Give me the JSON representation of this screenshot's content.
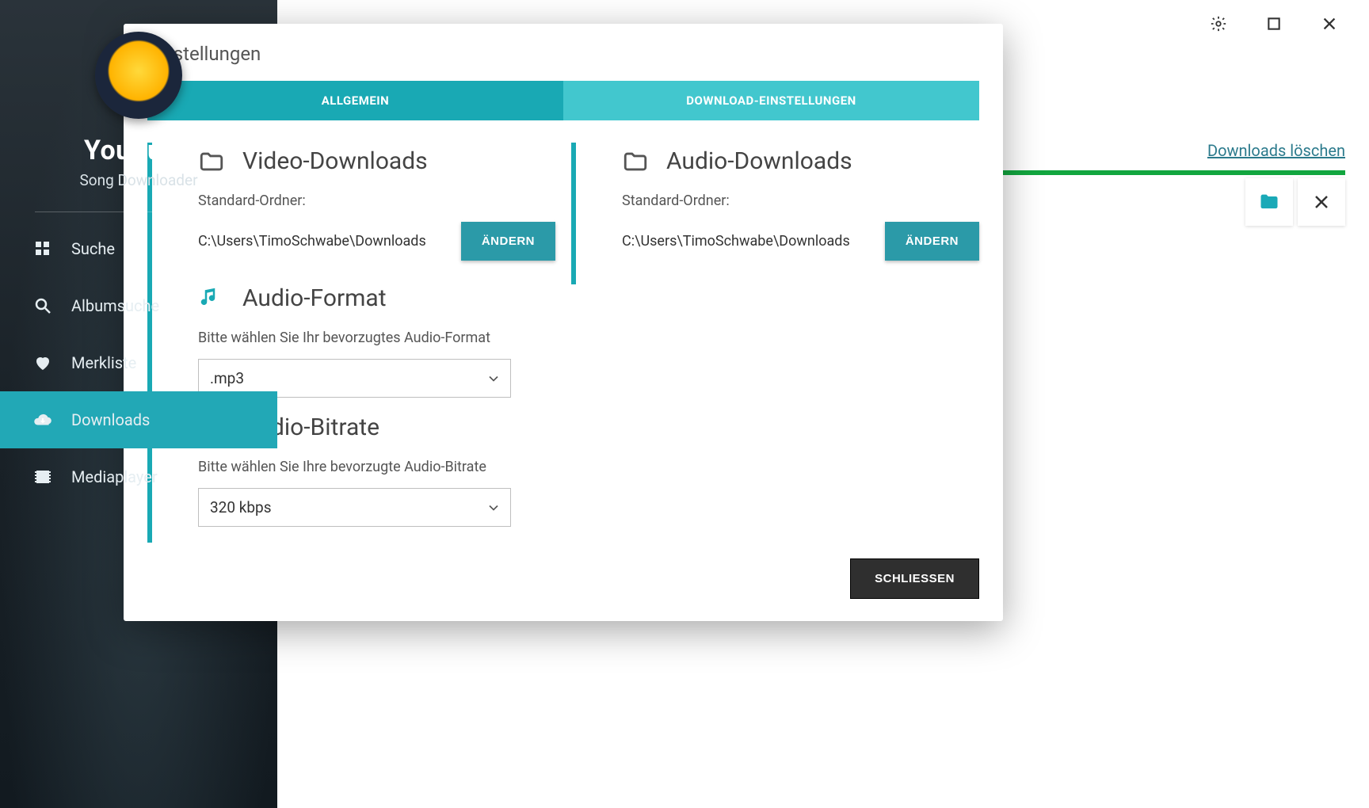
{
  "app": {
    "title": "YouTube",
    "subtitle": "Song Downloader"
  },
  "sidebar": {
    "items": [
      {
        "label": "Suche"
      },
      {
        "label": "Albumsuche"
      },
      {
        "label": "Merkliste"
      },
      {
        "label": "Downloads"
      },
      {
        "label": "Mediaplayer"
      }
    ]
  },
  "header": {
    "delete_downloads": "Downloads löschen"
  },
  "modal": {
    "title": "Einstellungen",
    "tabs": {
      "general": "ALLGEMEIN",
      "download": "DOWNLOAD-EINSTELLUNGEN"
    },
    "video": {
      "heading": "Video-Downloads",
      "folder_label": "Standard-Ordner:",
      "folder_path": "C:\\Users\\TimoSchwabe\\Downloads",
      "change": "ÄNDERN"
    },
    "audio": {
      "heading": "Audio-Downloads",
      "folder_label": "Standard-Ordner:",
      "folder_path": "C:\\Users\\TimoSchwabe\\Downloads",
      "change": "ÄNDERN"
    },
    "format": {
      "heading": "Audio-Format",
      "hint": "Bitte wählen Sie Ihr bevorzugtes Audio-Format",
      "value": ".mp3"
    },
    "bitrate": {
      "heading": "Audio-Bitrate",
      "hint": "Bitte wählen Sie Ihre bevorzugte Audio-Bitrate",
      "value": "320 kbps"
    },
    "close": "SCHLIESSEN"
  }
}
